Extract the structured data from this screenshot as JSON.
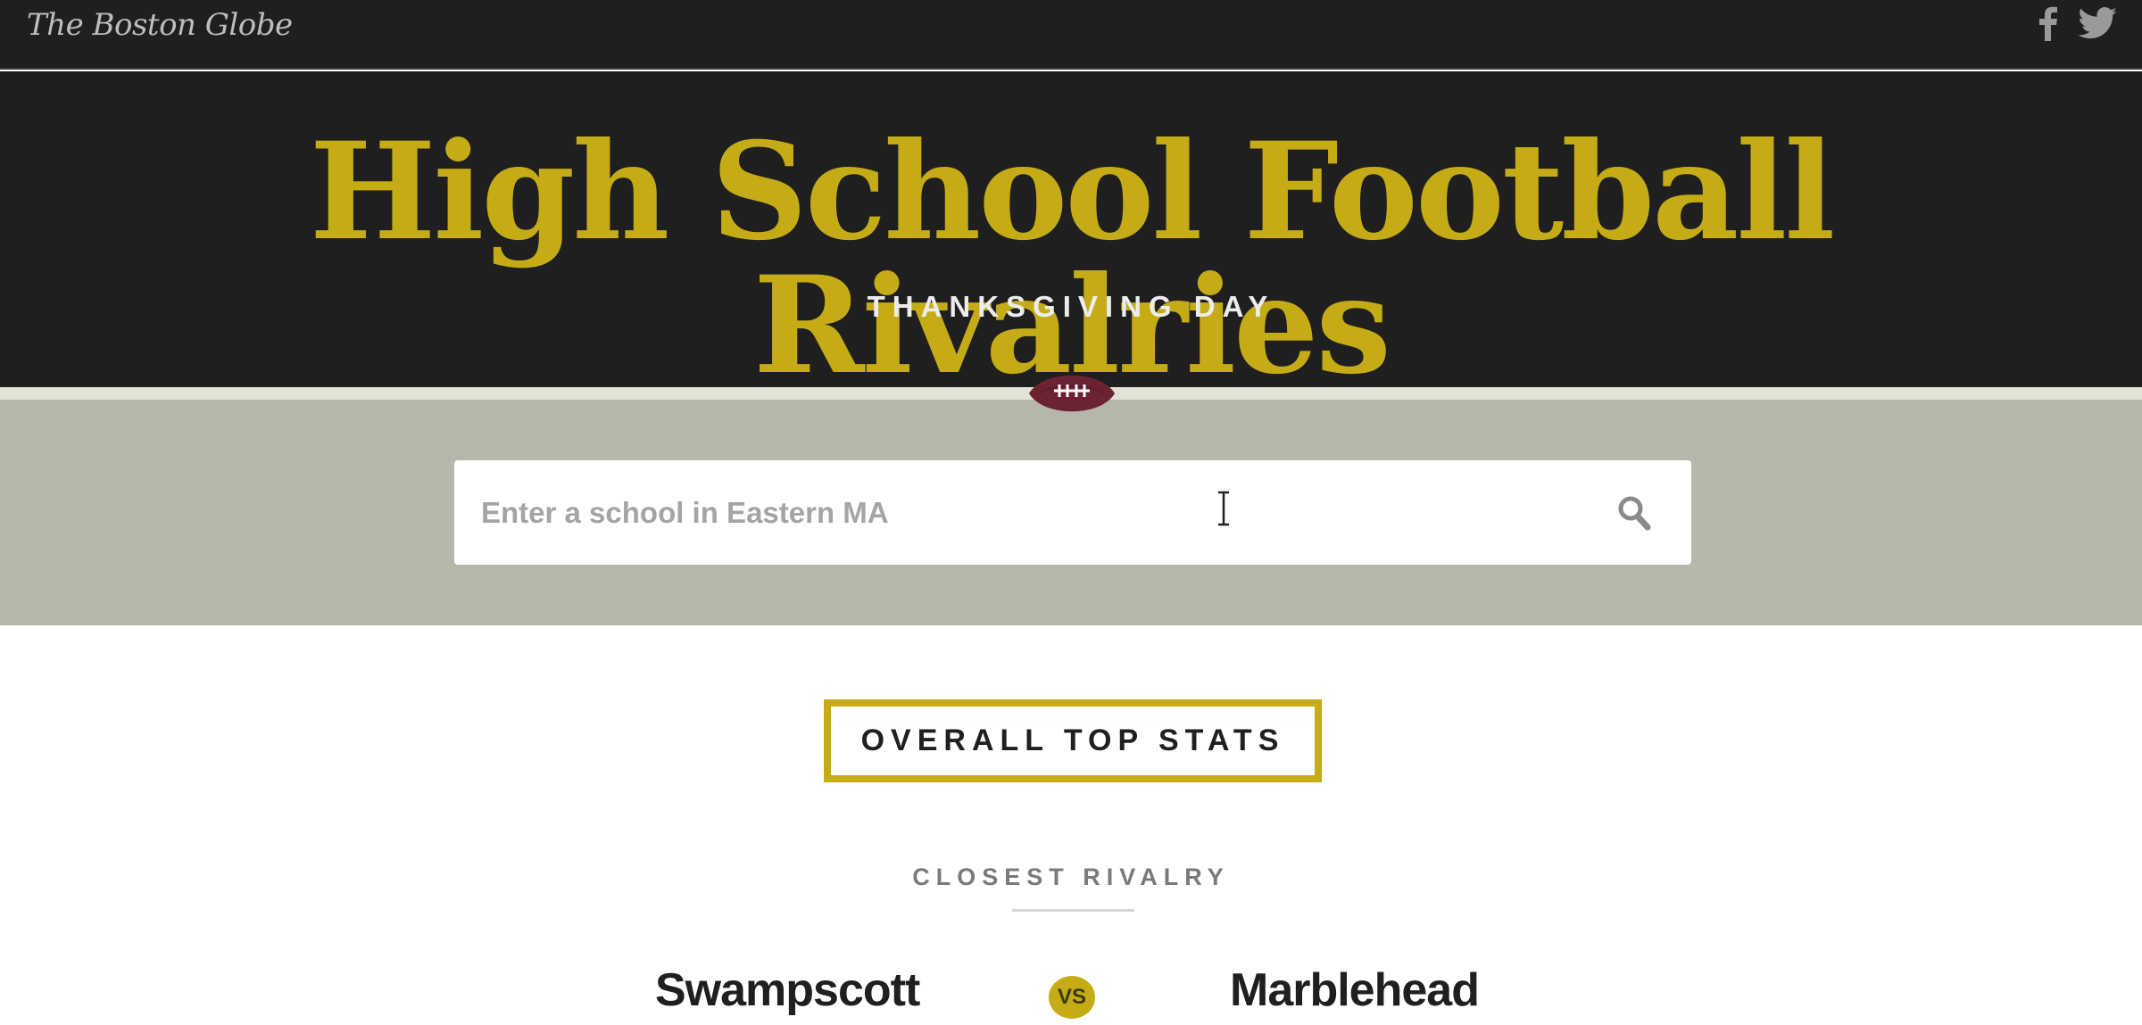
{
  "header": {
    "logo_text": "The Boston Globe",
    "social": [
      {
        "name": "facebook",
        "icon": "facebook-icon"
      },
      {
        "name": "twitter",
        "icon": "twitter-icon"
      }
    ]
  },
  "hero": {
    "title": "High School Football Rivalries",
    "subtitle": "THANKSGIVING DAY",
    "icon": "football-icon"
  },
  "search": {
    "placeholder": "Enter a school in Eastern MA",
    "value": "",
    "icon": "search-icon"
  },
  "stats": {
    "heading": "OVERALL TOP STATS",
    "closest_rivalry": {
      "label": "CLOSEST RIVALRY",
      "team_a": "Swampscott",
      "vs_label": "VS",
      "team_b": "Marblehead"
    }
  },
  "colors": {
    "dark_bg": "#1f1f1f",
    "accent_gold": "#c5ac17",
    "search_band": "#b6b6aa",
    "football_maroon": "#6b2232"
  }
}
